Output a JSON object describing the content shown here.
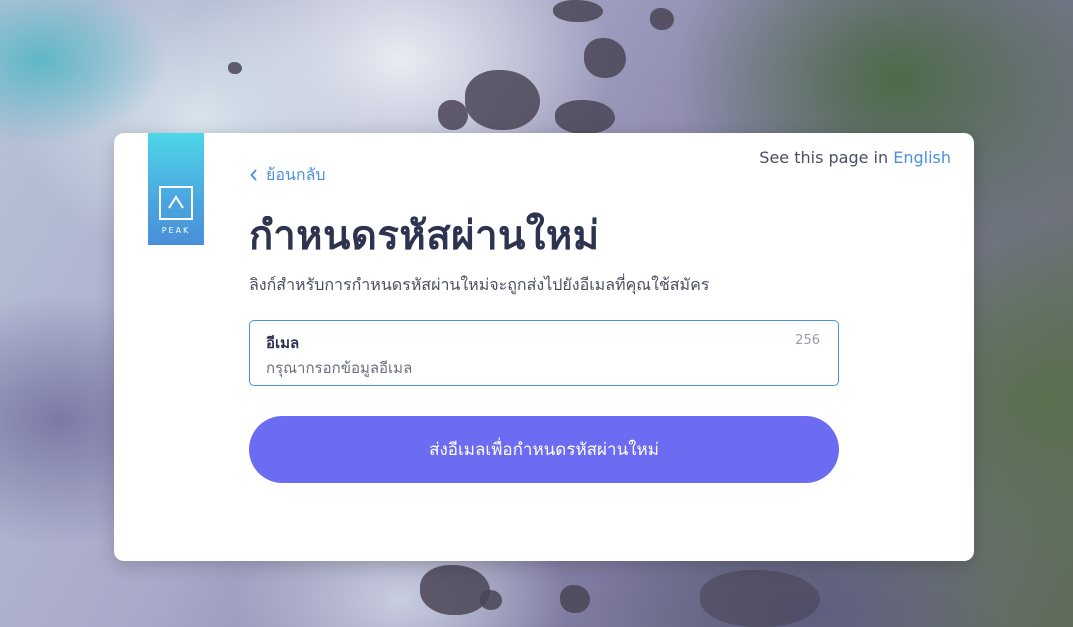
{
  "language_switch": {
    "prefix": "See this page in",
    "link": "English"
  },
  "logo": {
    "text": "PEAK"
  },
  "back_link": {
    "label": "ย้อนกลับ",
    "icon": "chevron-left-icon"
  },
  "page": {
    "title": "กำหนดรหัสผ่านใหม่",
    "subtitle": "ลิงก์สำหรับการกำหนดรหัสผ่านใหม่จะถูกส่งไปยังอีเมลที่คุณใช้สมัคร"
  },
  "email_field": {
    "label": "อีเมล",
    "max_length": "256",
    "placeholder": "กรุณากรอกข้อมูลอีเมล",
    "value": ""
  },
  "submit_button": {
    "label": "ส่งอีเมลเพื่อกำหนดรหัสผ่านใหม่"
  },
  "colors": {
    "accent": "#6c6cf2",
    "link": "#4a90e2",
    "title": "#2e3350"
  }
}
